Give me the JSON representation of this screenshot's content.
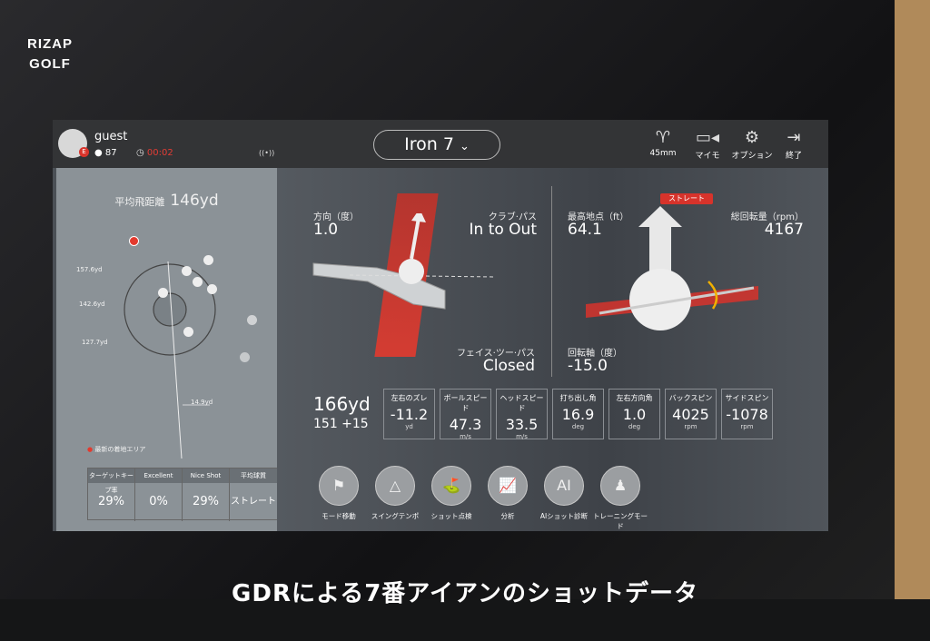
{
  "logo": "RIZAP GOLF",
  "caption": "GDRによる7番アイアンのショットデータ",
  "header": {
    "username": "guest",
    "user_badge": "E",
    "score": "87",
    "timer": "00:02",
    "club": "Iron 7",
    "actions": [
      {
        "label": "45mm",
        "icon": "tee-icon"
      },
      {
        "label": "マイモ",
        "icon": "video-camera-icon"
      },
      {
        "label": "オプション",
        "icon": "gear-icon"
      },
      {
        "label": "終了",
        "icon": "exit-icon"
      }
    ]
  },
  "left": {
    "avg_label": "平均飛距離",
    "avg_value": "146yd",
    "y_labels": [
      "157.6yd",
      "142.6yd",
      "127.7yd"
    ],
    "width_label": "14.9yd",
    "legend": "最新の着地エリア",
    "stats": [
      {
        "h": "ターゲットキープ率",
        "v": "29%"
      },
      {
        "h": "Excellent",
        "v": "0%"
      },
      {
        "h": "Nice Shot",
        "v": "29%"
      },
      {
        "h": "平均球質",
        "v": "ストレート"
      }
    ]
  },
  "main": {
    "direction": {
      "label": "方向（度）",
      "value": "1.0"
    },
    "club_path": {
      "label": "クラブ·パス",
      "value": "In to Out"
    },
    "face_to_path": {
      "label": "フェイス·ツー·パス",
      "value": "Closed"
    },
    "apex": {
      "label": "最高地点（ft）",
      "value": "64.1"
    },
    "total_spin": {
      "label": "総回転量（rpm）",
      "value": "4167"
    },
    "spin_axis": {
      "label": "回転軸（度）",
      "value": "-15.0"
    },
    "ball_type": "ストレート",
    "carry": "166yd",
    "carry_detail": "151 +15",
    "metrics": [
      {
        "t": "左右のズレ",
        "n": "-11.2",
        "u": "yd"
      },
      {
        "t": "ボールスピード",
        "n": "47.3",
        "u": "m/s"
      },
      {
        "t": "ヘッドスピード",
        "n": "33.5",
        "u": "m/s"
      },
      {
        "t": "打ち出し角",
        "n": "16.9",
        "u": "deg"
      },
      {
        "t": "左右方向角",
        "n": "1.0",
        "u": "deg"
      },
      {
        "t": "バックスピン",
        "n": "4025",
        "u": "rpm"
      },
      {
        "t": "サイドスピン",
        "n": "-1078",
        "u": "rpm"
      }
    ],
    "menu": [
      {
        "label": "モード移動",
        "icon": "flag-icon"
      },
      {
        "label": "スイングテンポ",
        "icon": "metronome-icon"
      },
      {
        "label": "ショット点検",
        "icon": "club-ball-icon"
      },
      {
        "label": "分析",
        "icon": "chart-icon"
      },
      {
        "label": "AIショット診断",
        "icon": "ai-club-icon"
      },
      {
        "label": "トレーニングモード",
        "icon": "training-icon"
      }
    ]
  },
  "colors": {
    "accent": "#e33a2e",
    "timer": "#e43c35"
  }
}
